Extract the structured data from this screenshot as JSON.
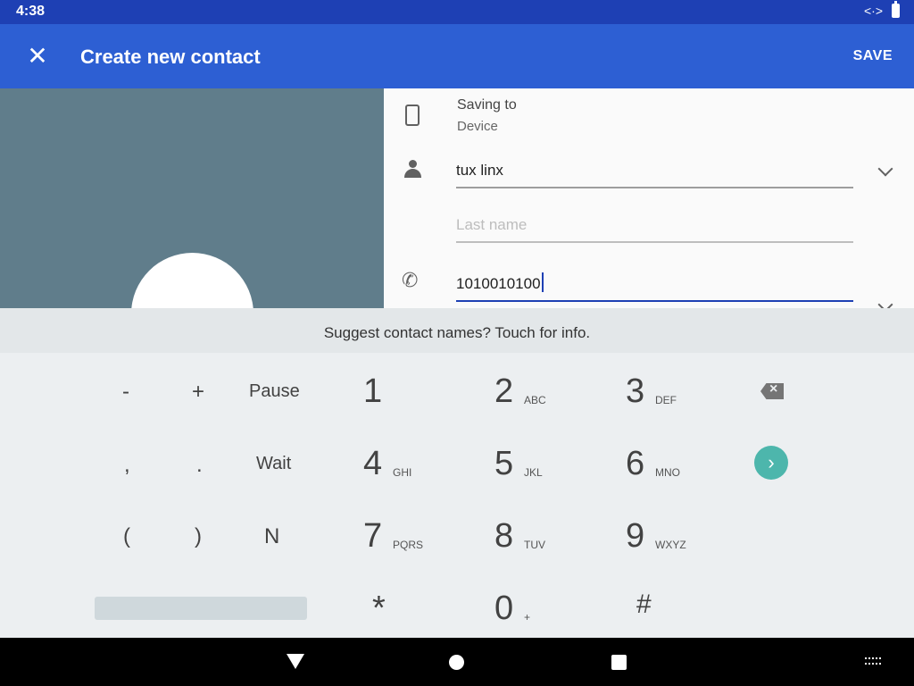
{
  "status_bar": {
    "time": "4:38",
    "network_icon": "data-transfer-icon",
    "battery_icon": "battery-icon"
  },
  "app_bar": {
    "close_icon": "close-icon",
    "title": "Create new contact",
    "save_label": "SAVE"
  },
  "form": {
    "saving_to_label": "Saving to",
    "saving_to_value": "Device",
    "name_value": "tux linx",
    "last_name_placeholder": "Last name",
    "phone_value": "1010010100"
  },
  "suggest_text": "Suggest contact names? Touch for info.",
  "keypad": {
    "symbols": [
      "-",
      "+",
      "Pause",
      ",",
      ".",
      "Wait",
      "(",
      ")",
      "N"
    ],
    "digits": [
      {
        "d": "1",
        "l": ""
      },
      {
        "d": "2",
        "l": "ABC"
      },
      {
        "d": "3",
        "l": "DEF"
      },
      {
        "d": "4",
        "l": "GHI"
      },
      {
        "d": "5",
        "l": "JKL"
      },
      {
        "d": "6",
        "l": "MNO"
      },
      {
        "d": "7",
        "l": "PQRS"
      },
      {
        "d": "8",
        "l": "TUV"
      },
      {
        "d": "9",
        "l": "WXYZ"
      },
      {
        "d": "*",
        "l": ""
      },
      {
        "d": "0",
        "l": "+"
      },
      {
        "d": "#",
        "l": ""
      }
    ],
    "next_icon": "chevron-right-icon",
    "backspace_icon": "backspace-icon"
  },
  "colors": {
    "status_bar": "#1e40b4",
    "app_bar": "#2d5fd3",
    "photo": "#607d8b",
    "accent": "#4db6ac"
  }
}
